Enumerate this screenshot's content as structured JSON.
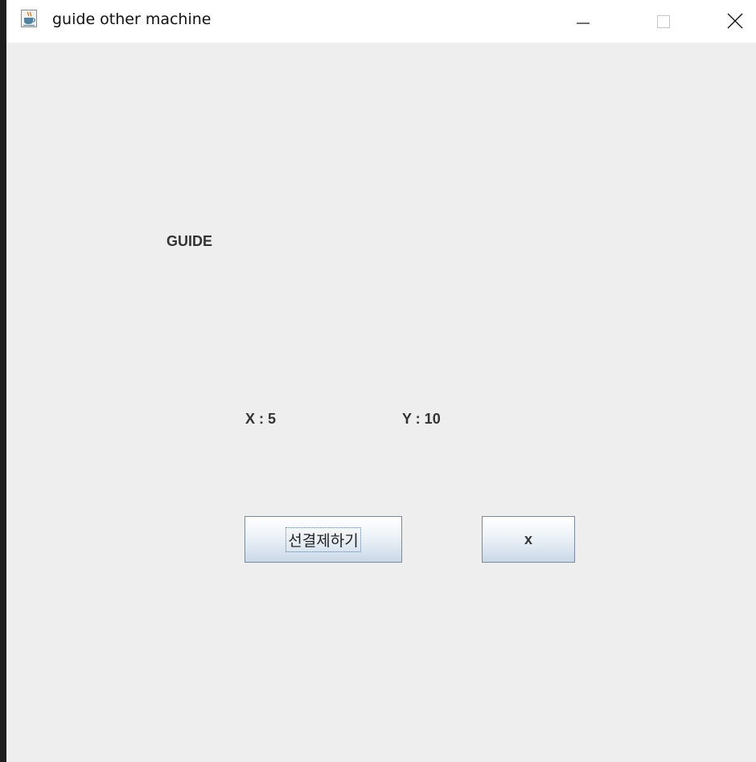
{
  "window": {
    "title": "guide other machine",
    "app_icon": "java-cup-icon",
    "controls": {
      "minimize": "minimize-icon",
      "maximize": "maximize-icon",
      "close": "close-icon"
    }
  },
  "main": {
    "heading": "GUIDE",
    "x_label": "X : 5",
    "y_label": "Y : 10",
    "release_button_label": "선결제하기",
    "x_button_label": "x"
  }
}
